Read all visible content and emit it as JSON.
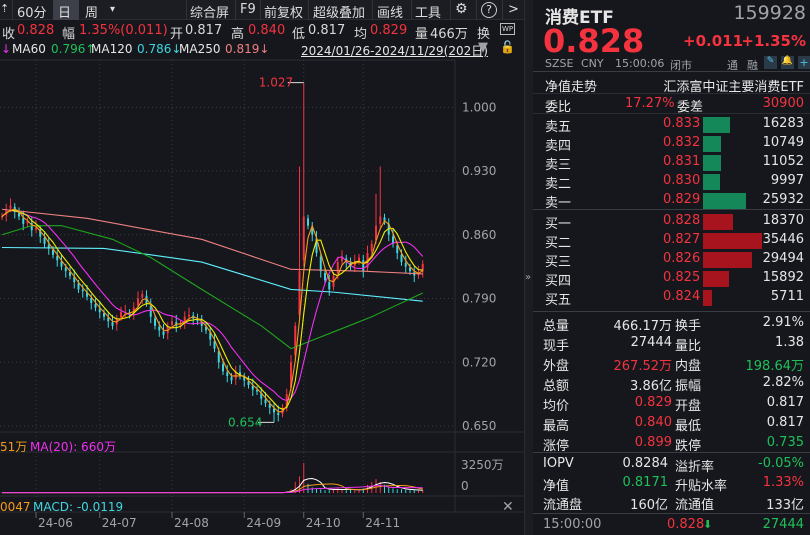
{
  "toolbar": {
    "left_icon": "up-arrow",
    "period_60": "60分",
    "period_day": "日",
    "period_week": "周",
    "more": "▾",
    "items": [
      "综合屏",
      "F9",
      "前复权",
      "超级叠加",
      "画线",
      "工具"
    ],
    "settings_icon": "gear-icon",
    "help": "?",
    "next": ">"
  },
  "info": {
    "close_label": "收",
    "close": "0.828",
    "amp_label": "幅",
    "amp": "1.35%(0.011)",
    "open_label": "开",
    "open": "0.817",
    "high_label": "高",
    "high": "0.840",
    "low_label": "低",
    "low": "0.817",
    "avg_label": "均",
    "avg": "0.829",
    "vol_label": "量",
    "vol": "466万",
    "turn_label": "换",
    "wp": "WP"
  },
  "ma": {
    "ma60_label": "MA60",
    "ma60": "0.796↑",
    "ma120_label": "MA120",
    "ma120": "0.786↓",
    "ma250_label": "MA250",
    "ma250": "0.819↓",
    "range": "2024/01/26-2024/11/29(202日)"
  },
  "volume_legend": {
    "prev": "51万",
    "ma20": "MA(20): 660万",
    "axis_top": "3250万",
    "axis_zero": "0"
  },
  "macd_legend": {
    "prev": "0047",
    "macd": "MACD: -0.0119"
  },
  "colors": {
    "up": "#f5333f",
    "down": "#3fd6e0",
    "ma5": "#ffffff",
    "ma10": "#f49b1a",
    "ma20": "#f0f000",
    "ma30": "#f030f0",
    "ma60": "#1ea51e",
    "ma120": "#5ff0ff",
    "ma250": "#f08080",
    "bg": "#15171c"
  },
  "chart_data": {
    "type": "candlestick",
    "ylim": [
      0.642,
      1.04
    ],
    "y_ticks": [
      "1.000",
      "0.930",
      "0.860",
      "0.790",
      "0.720",
      "0.650"
    ],
    "x_ticks": [
      "24-06",
      "24-07",
      "24-08",
      "24-09",
      "24-10",
      "24-11"
    ],
    "x_tick_index": [
      8,
      23,
      40,
      57,
      71,
      85
    ],
    "max_label": "1.027",
    "min_label": "0.654",
    "max_index": 71,
    "min_index": 64,
    "closes": [
      0.88,
      0.888,
      0.892,
      0.885,
      0.88,
      0.872,
      0.875,
      0.865,
      0.868,
      0.858,
      0.85,
      0.845,
      0.838,
      0.832,
      0.825,
      0.82,
      0.815,
      0.808,
      0.8,
      0.798,
      0.792,
      0.785,
      0.78,
      0.775,
      0.77,
      0.765,
      0.76,
      0.768,
      0.775,
      0.775,
      0.772,
      0.78,
      0.79,
      0.795,
      0.785,
      0.77,
      0.76,
      0.755,
      0.75,
      0.76,
      0.765,
      0.76,
      0.762,
      0.77,
      0.772,
      0.768,
      0.765,
      0.76,
      0.755,
      0.745,
      0.735,
      0.72,
      0.71,
      0.705,
      0.7,
      0.71,
      0.705,
      0.7,
      0.695,
      0.69,
      0.688,
      0.68,
      0.675,
      0.67,
      0.665,
      0.662,
      0.67,
      0.685,
      0.72,
      0.76,
      0.82,
      0.88,
      0.87,
      0.86,
      0.84,
      0.82,
      0.81,
      0.8,
      0.815,
      0.83,
      0.835,
      0.83,
      0.825,
      0.83,
      0.835,
      0.82,
      0.84,
      0.85,
      0.87,
      0.88,
      0.875,
      0.86,
      0.85,
      0.84,
      0.83,
      0.825,
      0.82,
      0.815,
      0.818,
      0.828
    ],
    "highs_override": {
      "70": 0.935,
      "71": 1.027,
      "88": 0.905,
      "89": 0.935
    },
    "lows_override": {
      "64": 0.654
    },
    "ma60": [
      [
        0,
        0.86
      ],
      [
        7,
        0.87
      ],
      [
        14,
        0.87
      ],
      [
        26,
        0.855
      ],
      [
        35,
        0.835
      ],
      [
        47,
        0.8
      ],
      [
        61,
        0.76
      ],
      [
        68,
        0.735
      ],
      [
        80,
        0.757
      ],
      [
        87,
        0.77
      ],
      [
        99,
        0.796
      ]
    ],
    "ma120": [
      [
        0,
        0.846
      ],
      [
        24,
        0.845
      ],
      [
        35,
        0.838
      ],
      [
        47,
        0.83
      ],
      [
        68,
        0.8
      ],
      [
        78,
        0.797
      ],
      [
        99,
        0.787
      ]
    ],
    "ma250": [
      [
        0,
        0.888
      ],
      [
        20,
        0.878
      ],
      [
        47,
        0.855
      ],
      [
        68,
        0.822
      ],
      [
        85,
        0.82
      ],
      [
        99,
        0.817
      ]
    ],
    "volume_ylim": [
      0,
      3250
    ],
    "volumes": [
      40,
      40,
      40,
      40,
      40,
      40,
      40,
      40,
      40,
      40,
      40,
      40,
      40,
      40,
      40,
      40,
      40,
      40,
      40,
      40,
      40,
      40,
      40,
      40,
      40,
      40,
      40,
      40,
      40,
      40,
      40,
      40,
      40,
      40,
      40,
      40,
      40,
      40,
      40,
      40,
      40,
      40,
      40,
      40,
      40,
      40,
      40,
      40,
      40,
      40,
      40,
      40,
      40,
      40,
      40,
      40,
      40,
      40,
      40,
      40,
      40,
      40,
      40,
      40,
      40,
      40,
      60,
      200,
      400,
      1200,
      1800,
      3250,
      1000,
      600,
      500,
      400,
      300,
      300,
      400,
      500,
      400,
      300,
      350,
      300,
      400,
      500,
      900,
      1200,
      1500,
      1200,
      900,
      600,
      500,
      400,
      400,
      350,
      300,
      300,
      250,
      300
    ]
  },
  "quote": {
    "name": "消费ETF",
    "code": "159928",
    "price": "0.828",
    "change": "+0.011",
    "change_pct": "+1.35%",
    "exchange": "SZSE",
    "currency": "CNY",
    "time": "15:00:06",
    "status": "闭市",
    "tong": "通",
    "rong": "融"
  },
  "nav": {
    "label": "净值走势",
    "fund": "汇添富中证主要消费ETF"
  },
  "weibi": {
    "label": "委比",
    "value": "17.27%",
    "diff_label": "委差",
    "diff": "30900"
  },
  "asks": [
    {
      "label": "卖五",
      "price": "0.833",
      "vol": "16283",
      "v": 16283
    },
    {
      "label": "卖四",
      "price": "0.832",
      "vol": "10749",
      "v": 10749
    },
    {
      "label": "卖三",
      "price": "0.831",
      "vol": "11052",
      "v": 11052
    },
    {
      "label": "卖二",
      "price": "0.830",
      "vol": "9997",
      "v": 9997
    },
    {
      "label": "卖一",
      "price": "0.829",
      "vol": "25932",
      "v": 25932
    }
  ],
  "bids": [
    {
      "label": "买一",
      "price": "0.828",
      "vol": "18370",
      "v": 18370
    },
    {
      "label": "买二",
      "price": "0.827",
      "vol": "35446",
      "v": 35446
    },
    {
      "label": "买三",
      "price": "0.826",
      "vol": "29494",
      "v": 29494
    },
    {
      "label": "买四",
      "price": "0.825",
      "vol": "15892",
      "v": 15892
    },
    {
      "label": "买五",
      "price": "0.824",
      "vol": "5711",
      "v": 5711
    }
  ],
  "stats": [
    {
      "l1": "总量",
      "v1": "466.17万",
      "c1": "white",
      "l2": "换手",
      "v2": "2.91%",
      "c2": "white"
    },
    {
      "l1": "现手",
      "v1": "27444",
      "c1": "white",
      "l2": "量比",
      "v2": "1.38",
      "c2": "white"
    },
    {
      "l1": "外盘",
      "v1": "267.52万",
      "c1": "red",
      "l2": "内盘",
      "v2": "198.64万",
      "c2": "green"
    },
    {
      "l1": "总额",
      "v1": "3.86亿",
      "c1": "white",
      "l2": "振幅",
      "v2": "2.82%",
      "c2": "white"
    },
    {
      "l1": "均价",
      "v1": "0.829",
      "c1": "red",
      "l2": "开盘",
      "v2": "0.817",
      "c2": "white"
    },
    {
      "l1": "最高",
      "v1": "0.840",
      "c1": "red",
      "l2": "最低",
      "v2": "0.817",
      "c2": "white"
    },
    {
      "l1": "涨停",
      "v1": "0.899",
      "c1": "red",
      "l2": "跌停",
      "v2": "0.735",
      "c2": "green"
    }
  ],
  "etf": [
    {
      "l1": "IOPV",
      "v1": "0.8284",
      "c1": "white",
      "l2": "溢折率",
      "v2": "-0.05%",
      "c2": "green"
    },
    {
      "l1": "净值",
      "v1": "0.8171",
      "c1": "green",
      "l2": "升贴水率",
      "v2": "1.33%",
      "c2": "red"
    },
    {
      "l1": "流通盘",
      "v1": "160亿",
      "c1": "white",
      "l2": "流通值",
      "v2": "133亿",
      "c2": "white"
    }
  ],
  "tick": {
    "time": "15:00:00",
    "price": "0.828",
    "vol": "27444"
  }
}
